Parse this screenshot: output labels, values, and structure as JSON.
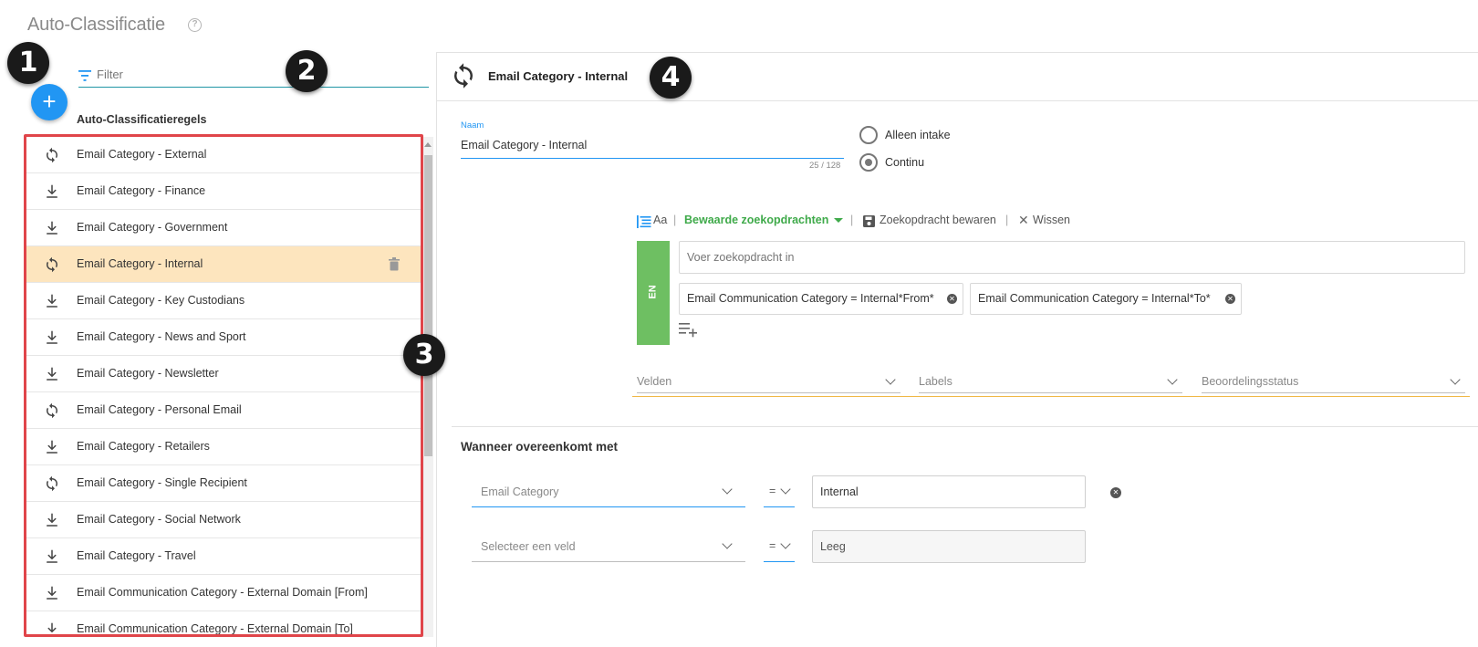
{
  "page": {
    "title": "Auto-Classificatie",
    "help_icon": "?"
  },
  "badges": [
    "1",
    "2",
    "3",
    "4"
  ],
  "left": {
    "add_icon": "+",
    "filter_placeholder": "Filter",
    "rules_header": "Auto-Classificatieregels",
    "rules": [
      {
        "label": "Email Category - External",
        "icon": "sync-icon"
      },
      {
        "label": "Email Category - Finance",
        "icon": "download-icon"
      },
      {
        "label": "Email Category - Government",
        "icon": "download-icon"
      },
      {
        "label": "Email Category - Internal",
        "icon": "sync-icon",
        "selected": true
      },
      {
        "label": "Email Category - Key Custodians",
        "icon": "download-icon"
      },
      {
        "label": "Email Category - News and Sport",
        "icon": "download-icon"
      },
      {
        "label": "Email Category - Newsletter",
        "icon": "download-icon"
      },
      {
        "label": "Email Category - Personal Email",
        "icon": "sync-icon"
      },
      {
        "label": "Email Category - Retailers",
        "icon": "download-icon"
      },
      {
        "label": "Email Category - Single Recipient",
        "icon": "sync-icon"
      },
      {
        "label": "Email Category - Social Network",
        "icon": "download-icon"
      },
      {
        "label": "Email Category - Travel",
        "icon": "download-icon"
      },
      {
        "label": "Email Communication Category - External Domain [From]",
        "icon": "download-icon"
      },
      {
        "label": "Email Communication Category - External Domain [To]",
        "icon": "download-icon"
      }
    ]
  },
  "detail": {
    "title": "Email Category - Internal",
    "name_label": "Naam",
    "name_value": "Email Category - Internal",
    "name_counter": "25 / 128",
    "radio_intake": "Alleen intake",
    "radio_continu": "Continu",
    "toolbar": {
      "aa": "Aa",
      "saved_searches": "Bewaarde zoekopdrachten",
      "save_search": "Zoekopdracht bewaren",
      "clear": "Wissen"
    },
    "en_label": "EN",
    "query_placeholder": "Voer zoekopdracht in",
    "chips": [
      "Email Communication Category = Internal*From*",
      "Email Communication Category = Internal*To*"
    ],
    "selects": {
      "fields": "Velden",
      "labels": "Labels",
      "review_status": "Beoordelingsstatus"
    },
    "section_title": "Wanneer overeenkomt met",
    "conditions": [
      {
        "field": "Email Category",
        "operator": "=",
        "value": "Internal"
      },
      {
        "field": "Selecteer een veld",
        "operator": "=",
        "value": "Leeg"
      }
    ]
  },
  "colors": {
    "accent_blue": "#2196f3",
    "green": "#6ebf62",
    "selected_row": "#fde5be",
    "highlight_frame": "#e0454a"
  }
}
